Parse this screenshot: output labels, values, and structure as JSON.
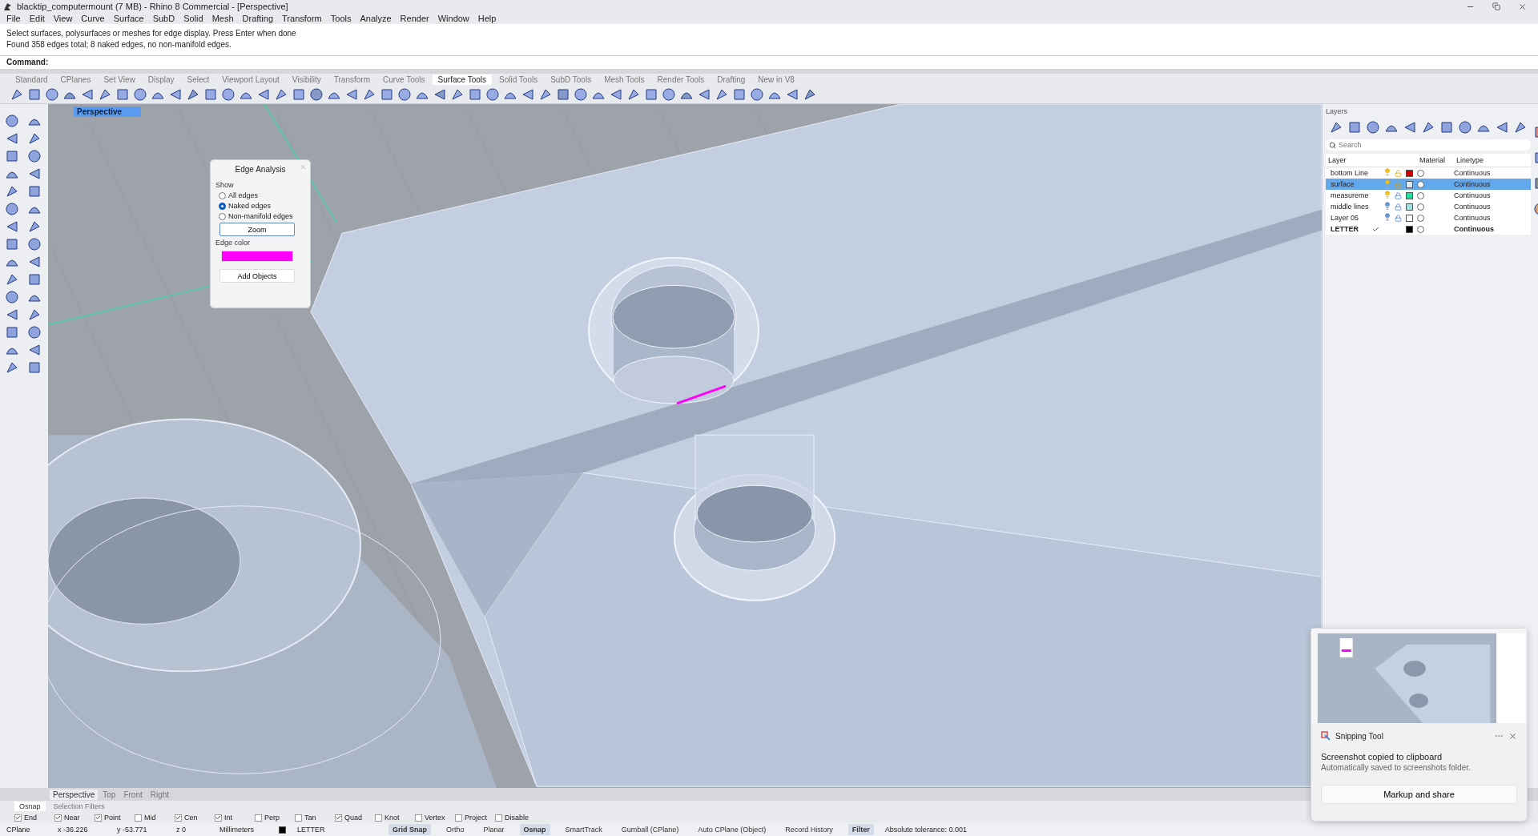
{
  "window": {
    "title": "blacktip_computermount (7 MB) - Rhino 8 Commercial - [Perspective]"
  },
  "menu": [
    "File",
    "Edit",
    "View",
    "Curve",
    "Surface",
    "SubD",
    "Solid",
    "Mesh",
    "Drafting",
    "Transform",
    "Tools",
    "Analyze",
    "Render",
    "Window",
    "Help"
  ],
  "command_history": [
    "Select surfaces, polysurfaces or meshes for edge display. Press Enter when done",
    "Found 358 edges total; 8 naked edges, no non-manifold edges."
  ],
  "command_prompt": "Command:",
  "toolbar_tabs": [
    {
      "label": "Standard",
      "selected": false
    },
    {
      "label": "CPlanes",
      "selected": false
    },
    {
      "label": "Set View",
      "selected": false
    },
    {
      "label": "Display",
      "selected": false
    },
    {
      "label": "Select",
      "selected": false
    },
    {
      "label": "Viewport Layout",
      "selected": false
    },
    {
      "label": "Visibility",
      "selected": false
    },
    {
      "label": "Transform",
      "selected": false
    },
    {
      "label": "Curve Tools",
      "selected": false
    },
    {
      "label": "Surface Tools",
      "selected": true
    },
    {
      "label": "Solid Tools",
      "selected": false
    },
    {
      "label": "SubD Tools",
      "selected": false
    },
    {
      "label": "Mesh Tools",
      "selected": false
    },
    {
      "label": "Render Tools",
      "selected": false
    },
    {
      "label": "Drafting",
      "selected": false
    },
    {
      "label": "New in V8",
      "selected": false
    }
  ],
  "viewport": {
    "title": "Perspective"
  },
  "edge_analysis": {
    "title": "Edge Analysis",
    "show_label": "Show",
    "options": [
      {
        "label": "All edges",
        "selected": false
      },
      {
        "label": "Naked edges",
        "selected": true
      },
      {
        "label": "Non-manifold edges",
        "selected": false
      }
    ],
    "zoom_button": "Zoom",
    "edge_color_label": "Edge color",
    "color": "#ff00ff",
    "add_objects_button": "Add Objects"
  },
  "layers": {
    "title": "Layers",
    "search_placeholder": "Search",
    "columns": [
      "Layer",
      "Material",
      "Linetype"
    ],
    "rows": [
      {
        "name": "bottom Line",
        "current": false,
        "selected": false,
        "visible": true,
        "locked": false,
        "color": "#cc0000",
        "linetype": "Continuous"
      },
      {
        "name": "surface",
        "current": false,
        "selected": true,
        "visible": true,
        "locked": false,
        "color": "#dce8f6",
        "linetype": "Continuous"
      },
      {
        "name": "measureme",
        "current": false,
        "selected": false,
        "visible": true,
        "locked": true,
        "color": "#1ee0a0",
        "linetype": "Continuous"
      },
      {
        "name": "middle lines",
        "current": false,
        "selected": false,
        "visible": false,
        "locked": true,
        "color": "#a0e0e0",
        "linetype": "Continuous"
      },
      {
        "name": "Layer 05",
        "current": false,
        "selected": false,
        "visible": false,
        "locked": true,
        "color": "#ffffff",
        "linetype": "Continuous"
      },
      {
        "name": "LETTER",
        "current": true,
        "selected": false,
        "color": "#000000",
        "linetype": "Continuous"
      }
    ]
  },
  "viewport_tabs": [
    {
      "label": "Perspective",
      "selected": true
    },
    {
      "label": "Top",
      "selected": false
    },
    {
      "label": "Front",
      "selected": false
    },
    {
      "label": "Right",
      "selected": false
    }
  ],
  "panel_tabs": [
    {
      "label": "Osnap",
      "selected": true
    },
    {
      "label": "Selection Filters",
      "selected": false
    }
  ],
  "osnaps": [
    {
      "label": "End",
      "checked": true
    },
    {
      "label": "Near",
      "checked": true
    },
    {
      "label": "Point",
      "checked": true
    },
    {
      "label": "Mid",
      "checked": false
    },
    {
      "label": "Cen",
      "checked": true
    },
    {
      "label": "Int",
      "checked": true
    },
    {
      "label": "Perp",
      "checked": false
    },
    {
      "label": "Tan",
      "checked": false
    },
    {
      "label": "Quad",
      "checked": true
    },
    {
      "label": "Knot",
      "checked": false
    },
    {
      "label": "Vertex",
      "checked": false
    },
    {
      "label": "Project",
      "checked": false
    },
    {
      "label": "Disable",
      "checked": false
    }
  ],
  "status_bar": {
    "cplane": "CPlane",
    "x": "x -36.226",
    "y": "y -53.771",
    "z": "z 0",
    "units": "Millimeters",
    "layer": {
      "name": "LETTER",
      "color": "#000000"
    },
    "toggles": [
      {
        "label": "Grid Snap",
        "on": true
      },
      {
        "label": "Ortho",
        "on": false
      },
      {
        "label": "Planar",
        "on": false
      },
      {
        "label": "Osnap",
        "on": true
      },
      {
        "label": "SmartTrack",
        "on": false
      },
      {
        "label": "Gumball (CPlane)",
        "on": false
      },
      {
        "label": "Auto CPlane (Object)",
        "on": false
      },
      {
        "label": "Record History",
        "on": false
      },
      {
        "label": "Filter",
        "on": true
      }
    ],
    "tolerance": "Absolute tolerance: 0.001"
  },
  "notification": {
    "app": "Snipping Tool",
    "title": "Screenshot copied to clipboard",
    "message": "Automatically saved to screenshots folder.",
    "button": "Markup and share"
  }
}
